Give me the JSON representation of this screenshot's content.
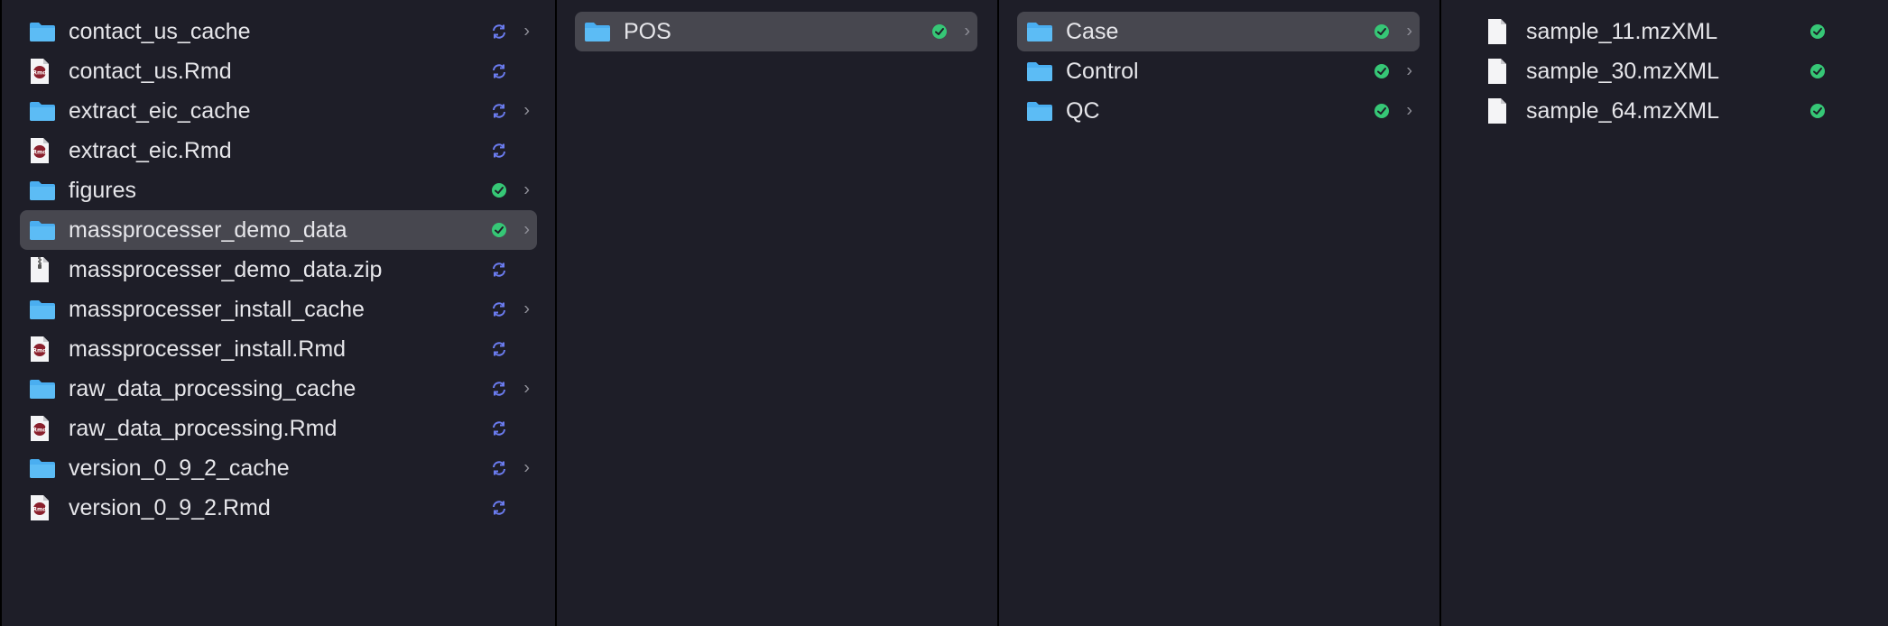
{
  "colors": {
    "background": "#1e1e28",
    "selected_row": "#47474f",
    "folder": "#4aaef0",
    "synced_status": "#36c776",
    "syncing_status": "#6b7cf0"
  },
  "columns": [
    {
      "items": [
        {
          "label": "contact_us_cache",
          "kind": "folder",
          "status": "syncing",
          "chevron": true,
          "selected": false
        },
        {
          "label": "contact_us.Rmd",
          "kind": "rmd",
          "status": "syncing",
          "chevron": false,
          "selected": false
        },
        {
          "label": "extract_eic_cache",
          "kind": "folder",
          "status": "syncing",
          "chevron": true,
          "selected": false
        },
        {
          "label": "extract_eic.Rmd",
          "kind": "rmd",
          "status": "syncing",
          "chevron": false,
          "selected": false
        },
        {
          "label": "figures",
          "kind": "folder",
          "status": "synced",
          "chevron": true,
          "selected": false
        },
        {
          "label": "massprocesser_demo_data",
          "kind": "folder",
          "status": "synced",
          "chevron": true,
          "selected": true
        },
        {
          "label": "massprocesser_demo_data.zip",
          "kind": "zip",
          "status": "syncing",
          "chevron": false,
          "selected": false
        },
        {
          "label": "massprocesser_install_cache",
          "kind": "folder",
          "status": "syncing",
          "chevron": true,
          "selected": false
        },
        {
          "label": "massprocesser_install.Rmd",
          "kind": "rmd",
          "status": "syncing",
          "chevron": false,
          "selected": false
        },
        {
          "label": "raw_data_processing_cache",
          "kind": "folder",
          "status": "syncing",
          "chevron": true,
          "selected": false
        },
        {
          "label": "raw_data_processing.Rmd",
          "kind": "rmd",
          "status": "syncing",
          "chevron": false,
          "selected": false
        },
        {
          "label": "version_0_9_2_cache",
          "kind": "folder",
          "status": "syncing",
          "chevron": true,
          "selected": false
        },
        {
          "label": "version_0_9_2.Rmd",
          "kind": "rmd",
          "status": "syncing",
          "chevron": false,
          "selected": false
        }
      ]
    },
    {
      "items": [
        {
          "label": "POS",
          "kind": "folder",
          "status": "synced",
          "chevron": true,
          "selected": true
        }
      ]
    },
    {
      "items": [
        {
          "label": "Case",
          "kind": "folder",
          "status": "synced",
          "chevron": true,
          "selected": true
        },
        {
          "label": "Control",
          "kind": "folder",
          "status": "synced",
          "chevron": true,
          "selected": false
        },
        {
          "label": "QC",
          "kind": "folder",
          "status": "synced",
          "chevron": true,
          "selected": false
        }
      ]
    },
    {
      "items": [
        {
          "label": "sample_11.mzXML",
          "kind": "doc",
          "status": "synced",
          "chevron": false,
          "selected": false
        },
        {
          "label": "sample_30.mzXML",
          "kind": "doc",
          "status": "synced",
          "chevron": false,
          "selected": false
        },
        {
          "label": "sample_64.mzXML",
          "kind": "doc",
          "status": "synced",
          "chevron": false,
          "selected": false
        }
      ]
    }
  ],
  "glyphs": {
    "chevron": "›"
  }
}
